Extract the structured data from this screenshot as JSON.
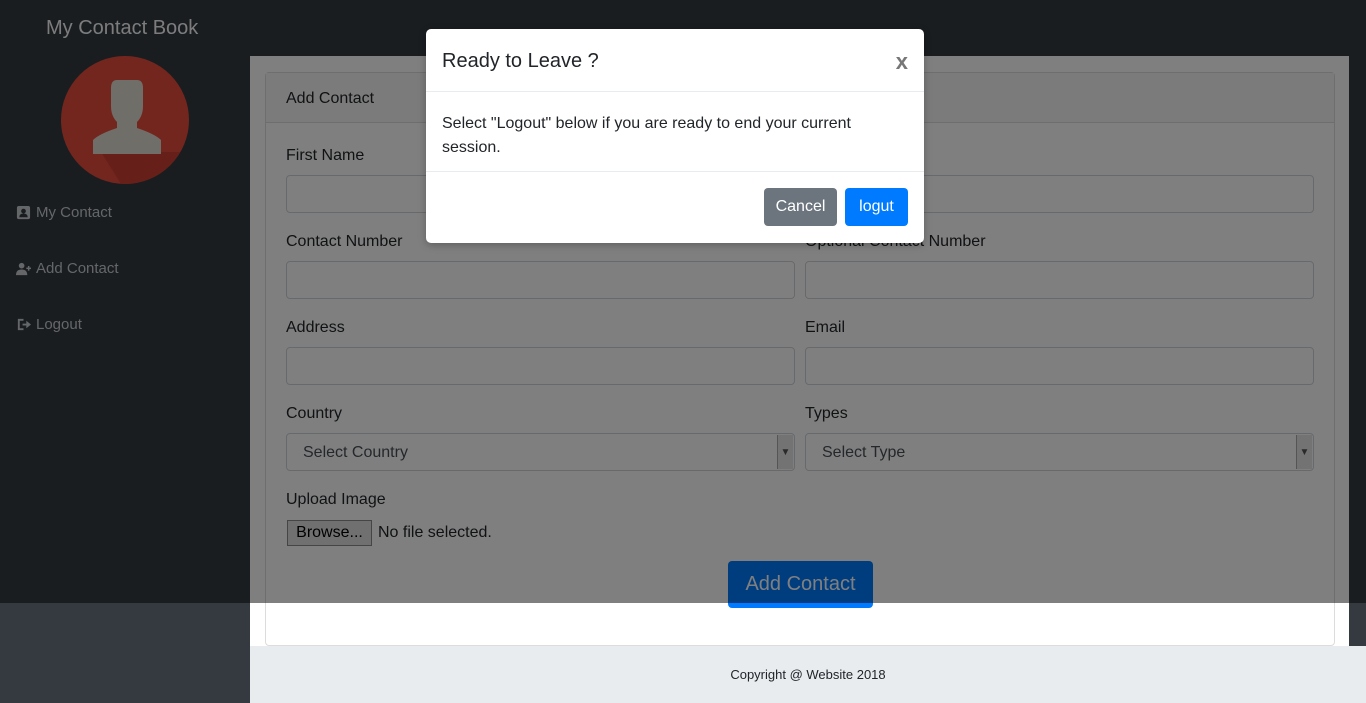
{
  "app": {
    "brand": "My Contact Book"
  },
  "sidebar": {
    "items": [
      {
        "label": "My Contact",
        "icon": "address-card-icon"
      },
      {
        "label": "Add Contact",
        "icon": "user-plus-icon"
      },
      {
        "label": "Logout",
        "icon": "sign-out-icon"
      }
    ]
  },
  "form": {
    "header": "Add Contact",
    "first_name_label": "First Name",
    "last_name_label": "",
    "contact_number_label": "Contact Number",
    "optional_contact_label": "Optional Contact Number",
    "address_label": "Address",
    "email_label": "Email",
    "country_label": "Country",
    "country_selected": "Select Country",
    "types_label": "Types",
    "types_selected": "Select Type",
    "upload_label": "Upload Image",
    "browse_label": "Browse...",
    "no_file_text": "No file selected.",
    "submit_label": "Add Contact"
  },
  "footer": {
    "copyright": "Copyright @ Website 2018"
  },
  "modal": {
    "title": "Ready to Leave ?",
    "close": "x",
    "body": "Select \"Logout\" below if you are ready to end your current session.",
    "cancel_label": "Cancel",
    "logout_label": "logut"
  },
  "colors": {
    "sidebar": "#343a40",
    "primary": "#007bff",
    "secondary": "#6c757d",
    "avatar": "#e74c3c"
  }
}
